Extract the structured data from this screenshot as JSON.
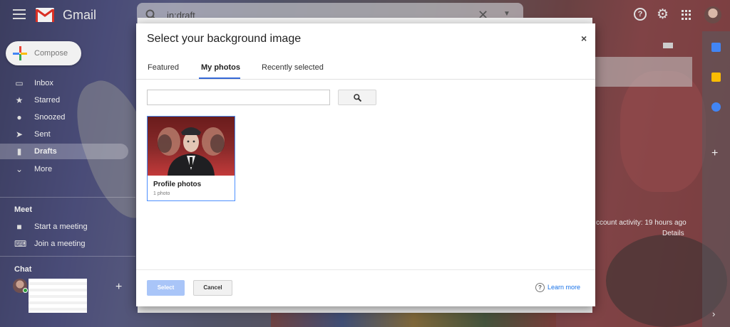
{
  "app": {
    "name": "Gmail",
    "search_query": "in:draft"
  },
  "sidebar": {
    "compose_label": "Compose",
    "items": [
      {
        "label": "Inbox",
        "icon": "inbox-icon"
      },
      {
        "label": "Starred",
        "icon": "star-icon"
      },
      {
        "label": "Snoozed",
        "icon": "clock-icon"
      },
      {
        "label": "Sent",
        "icon": "send-icon"
      },
      {
        "label": "Drafts",
        "icon": "draft-icon",
        "active": true
      },
      {
        "label": "More",
        "icon": "chevron-down-icon"
      }
    ],
    "meet": {
      "heading": "Meet",
      "items": [
        {
          "label": "Start a meeting",
          "icon": "video-icon"
        },
        {
          "label": "Join a meeting",
          "icon": "keyboard-icon"
        }
      ]
    },
    "chat_heading": "Chat"
  },
  "content": {
    "account_activity": "ccount activity: 19 hours ago",
    "details_link": "Details"
  },
  "dialog": {
    "title": "Select your background image",
    "close_label": "×",
    "tabs": [
      {
        "label": "Featured"
      },
      {
        "label": "My photos",
        "active": true
      },
      {
        "label": "Recently selected"
      }
    ],
    "search_value": "",
    "album": {
      "name": "Profile photos",
      "count": "1 photo"
    },
    "select_label": "Select",
    "cancel_label": "Cancel",
    "learn_more_label": "Learn more",
    "accent_color": "#3367d6"
  }
}
